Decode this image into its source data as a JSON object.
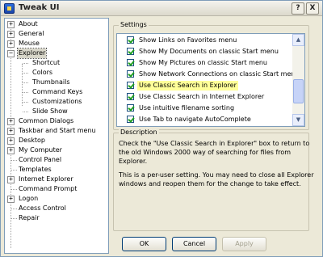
{
  "window": {
    "title": "Tweak UI"
  },
  "tree": {
    "items": [
      {
        "label": "About",
        "expander": "+"
      },
      {
        "label": "General",
        "expander": "+"
      },
      {
        "label": "Mouse",
        "expander": "+"
      },
      {
        "label": "Explorer",
        "expander": "−",
        "selected": true
      },
      {
        "label": "Shortcut"
      },
      {
        "label": "Colors"
      },
      {
        "label": "Thumbnails"
      },
      {
        "label": "Command Keys"
      },
      {
        "label": "Customizations"
      },
      {
        "label": "Slide Show"
      },
      {
        "label": "Common Dialogs",
        "expander": "+"
      },
      {
        "label": "Taskbar and Start menu",
        "expander": "+"
      },
      {
        "label": "Desktop",
        "expander": "+"
      },
      {
        "label": "My Computer",
        "expander": "+"
      },
      {
        "label": "Control Panel"
      },
      {
        "label": "Templates"
      },
      {
        "label": "Internet Explorer",
        "expander": "+"
      },
      {
        "label": "Command Prompt"
      },
      {
        "label": "Logon",
        "expander": "+"
      },
      {
        "label": "Access Control"
      },
      {
        "label": "Repair"
      }
    ]
  },
  "settings": {
    "title": "Settings",
    "options": [
      {
        "label": "Show Links on Favorites menu",
        "checked": true
      },
      {
        "label": "Show My Documents on classic Start menu",
        "checked": true
      },
      {
        "label": "Show My Pictures on classic Start menu",
        "checked": true
      },
      {
        "label": "Show Network Connections on classic Start menu",
        "checked": true
      },
      {
        "label": "Use Classic Search in Explorer",
        "checked": true,
        "highlighted": true
      },
      {
        "label": "Use Classic Search in Internet Explorer",
        "checked": true
      },
      {
        "label": "Use intuitive filename sorting",
        "checked": true
      },
      {
        "label": "Use Tab to navigate AutoComplete",
        "checked": true
      }
    ]
  },
  "description": {
    "title": "Description",
    "lines": [
      "Check the \"Use Classic Search in Explorer\" box to return to",
      "the old Windows 2000 way of searching for files from",
      "Explorer.",
      "",
      "This is a per-user setting.  You may need to close all Explorer",
      "windows and reopen them for the change to take effect."
    ]
  },
  "buttons": {
    "ok": "OK",
    "cancel": "Cancel",
    "apply": "Apply"
  },
  "titlebar_buttons": {
    "help": "?",
    "close": "X"
  }
}
